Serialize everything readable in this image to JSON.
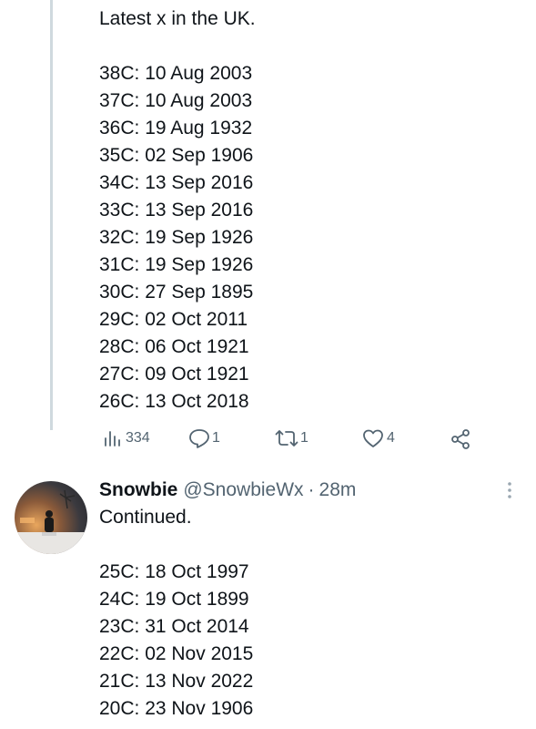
{
  "tweet1": {
    "intro": "Latest x in the UK.",
    "lines": [
      "38C: 10 Aug 2003",
      "37C: 10 Aug 2003",
      "36C: 19 Aug 1932",
      "35C: 02 Sep 1906",
      "34C: 13 Sep 2016",
      "33C: 13 Sep 2016",
      "32C: 19 Sep 1926",
      "31C: 19 Sep 1926",
      "30C: 27 Sep 1895",
      "29C: 02 Oct 2011",
      "28C: 06 Oct 1921",
      "27C: 09 Oct 1921",
      "26C: 13 Oct 2018"
    ],
    "views": "334",
    "replies": "1",
    "retweets": "1",
    "likes": "4"
  },
  "tweet2": {
    "name": "Snowbie",
    "handle": "@SnowbieWx",
    "separator": "·",
    "time": "28m",
    "intro": "Continued.",
    "lines": [
      "25C: 18 Oct 1997",
      "24C: 19 Oct 1899",
      "23C: 31 Oct 2014",
      "22C: 02 Nov 2015",
      "21C: 13 Nov 2022",
      "20C: 23 Nov 1906"
    ]
  },
  "icons": {
    "views": "bar-chart-icon",
    "reply": "reply-icon",
    "retweet": "retweet-icon",
    "like": "heart-icon",
    "share": "share-icon",
    "more": "more-options-icon"
  },
  "colors": {
    "text": "#0f1419",
    "muted": "#536471",
    "thread_line": "#cfd9de"
  }
}
